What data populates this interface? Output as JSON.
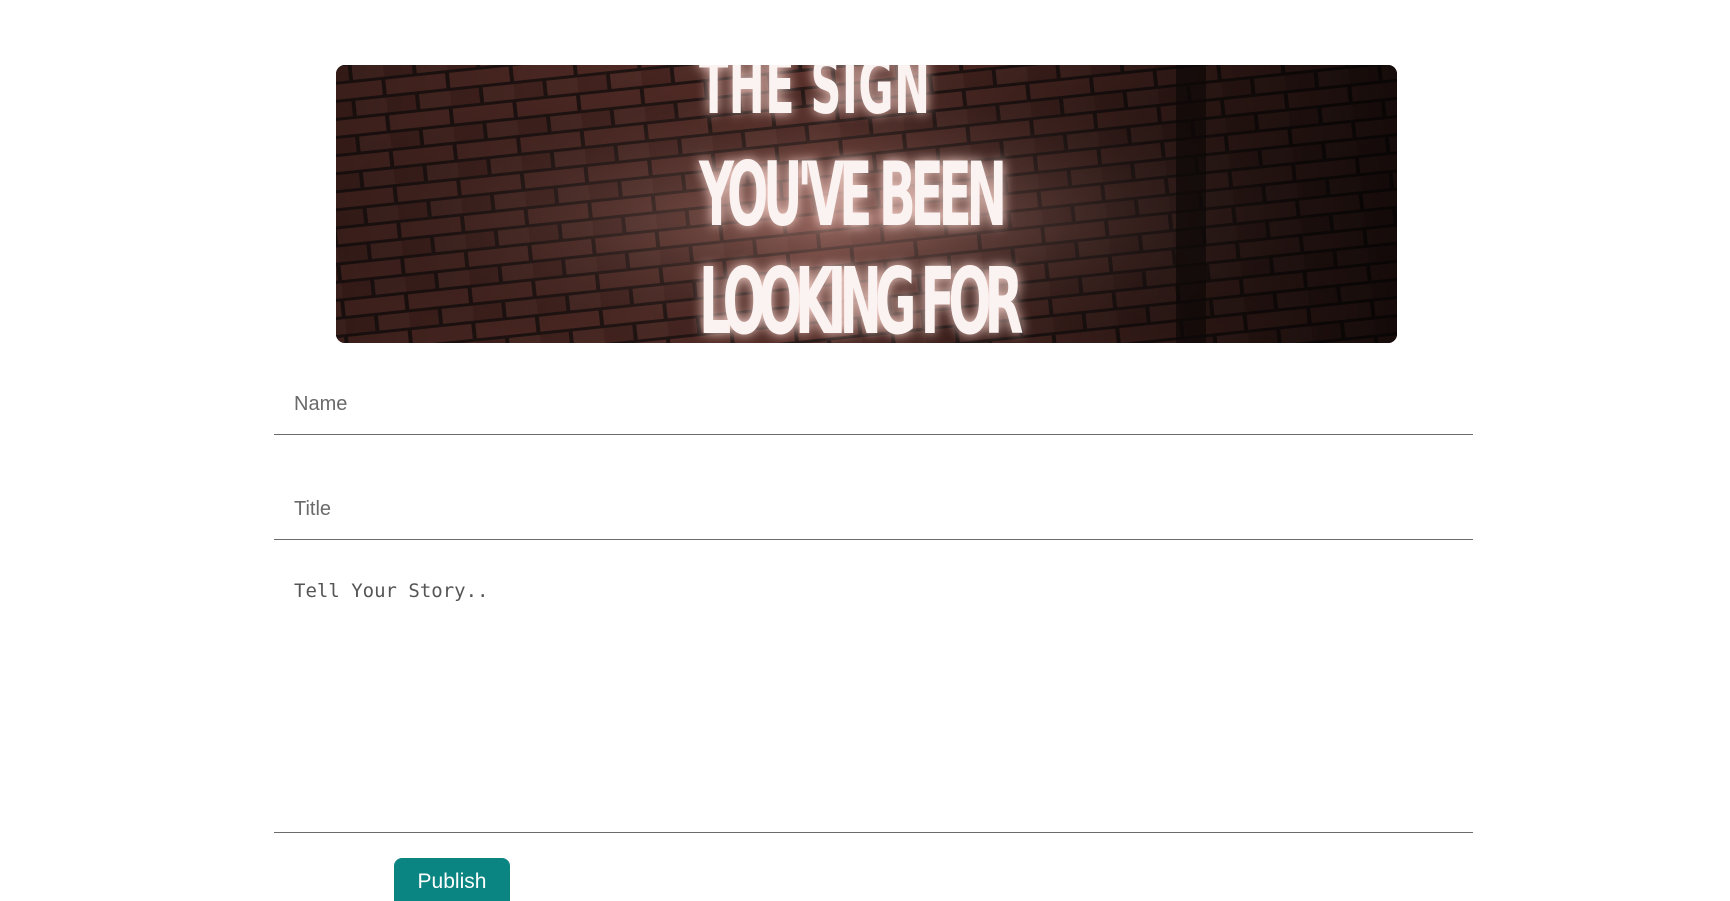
{
  "banner": {
    "image": "neon-sign-brick-wall",
    "neon_lines": [
      "THE SIGN",
      "YOU'VE BEEN",
      "LOOKING FOR"
    ]
  },
  "form": {
    "name_placeholder": "Name",
    "title_placeholder": "Title",
    "story_placeholder": "Tell Your Story..",
    "publish_label": "Publish"
  },
  "colors": {
    "accent": "#0a8582",
    "field_border": "#6b6b6b"
  }
}
